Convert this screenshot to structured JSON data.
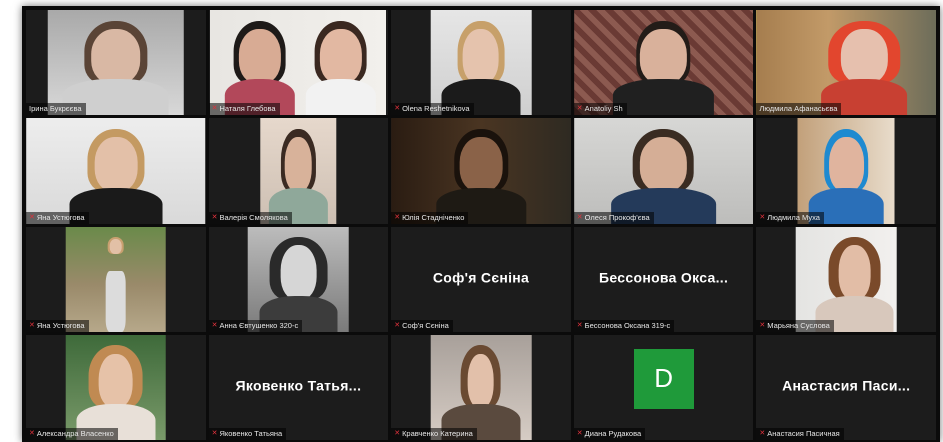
{
  "participants": [
    {
      "name": "Ірина Букрєєва",
      "muted": false
    },
    {
      "name": "Наталя Глебова",
      "muted": true
    },
    {
      "name": "Olena Reshetnikova",
      "muted": true
    },
    {
      "name": "Anatoliy Sh",
      "muted": true
    },
    {
      "name": "Людмила Афанасьєва",
      "muted": false,
      "active_speaker": true
    },
    {
      "name": "Яна Устюгова",
      "muted": true
    },
    {
      "name": "Валерія Смолякова",
      "muted": true
    },
    {
      "name": "Юлія Стадніченко",
      "muted": true
    },
    {
      "name": "Олеся Прокоф'єва",
      "muted": true
    },
    {
      "name": "Людмила Муха",
      "muted": true
    },
    {
      "name": "Яна Устюгова",
      "muted": true
    },
    {
      "name": "Анна Євтушенко 320-с",
      "muted": true
    },
    {
      "name": "Соф'я Сєніна",
      "muted": true,
      "display_name": "Соф'я Сєніна"
    },
    {
      "name": "Бессонова Оксана 319-с",
      "muted": true,
      "display_name": "Бессонова Окса..."
    },
    {
      "name": "Марьяна Суслова",
      "muted": true
    },
    {
      "name": "Александра Власенко",
      "muted": true
    },
    {
      "name": "Яковенко Татьяна",
      "muted": true,
      "display_name": "Яковенко Татья..."
    },
    {
      "name": "Кравченко Катерина",
      "muted": true
    },
    {
      "name": "Диана Рудакова",
      "muted": true,
      "avatar_letter": "D"
    },
    {
      "name": "Анастасия Пасичная",
      "muted": true,
      "display_name": "Анастасия Паси..."
    }
  ],
  "colors": {
    "active_speaker_border": "#c8d94a",
    "mute_icon": "#e0323c",
    "avatar_bg": "#1f9a3a",
    "tile_bg": "#1c1c1c"
  },
  "icons": {
    "muted": "mic-off-icon"
  }
}
